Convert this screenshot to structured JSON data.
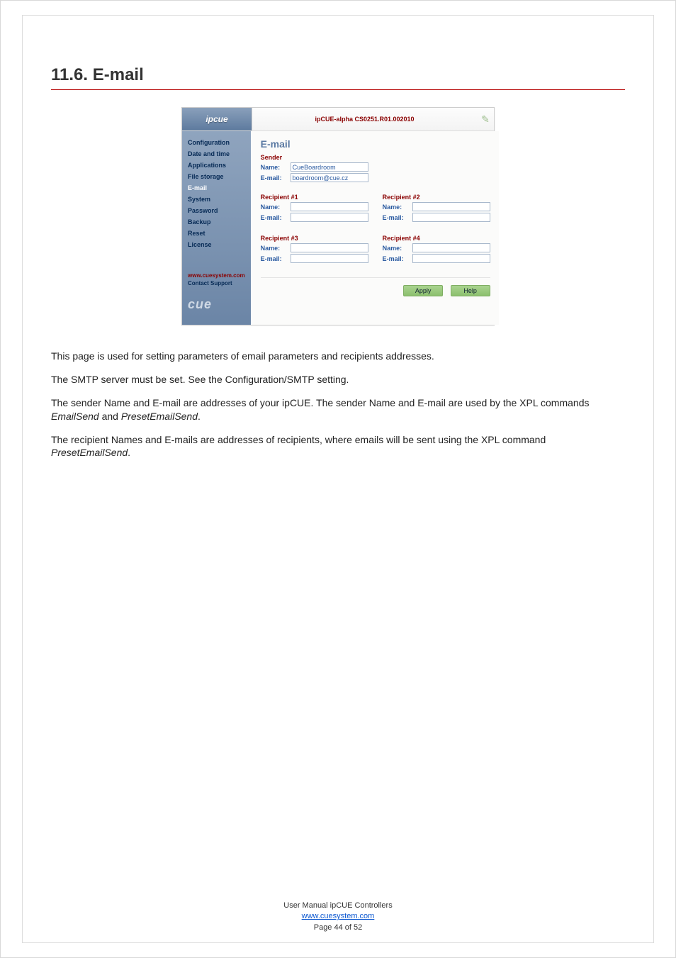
{
  "heading": "11.6.   E-mail",
  "screenshot": {
    "logo": "ipcue",
    "breadcrumb": "ipCUE-alpha   CS0251.R01.002010",
    "nav": {
      "items": [
        {
          "label": "Configuration",
          "active": false
        },
        {
          "label": "Date and time",
          "active": false
        },
        {
          "label": "Applications",
          "active": false
        },
        {
          "label": "File storage",
          "active": false
        },
        {
          "label": "E-mail",
          "active": true
        },
        {
          "label": "System",
          "active": false
        },
        {
          "label": "Password",
          "active": false
        },
        {
          "label": "Backup",
          "active": false
        },
        {
          "label": "Reset",
          "active": false
        },
        {
          "label": "License",
          "active": false
        }
      ],
      "link1": "www.cuesystem.com",
      "link2": "Contact Support",
      "brand": "cue"
    },
    "content": {
      "title": "E-mail",
      "sender": {
        "heading": "Sender",
        "name_label": "Name:",
        "name_value": "CueBoardroom",
        "email_label": "E-mail:",
        "email_value": "boardroom@cue.cz"
      },
      "recipients": [
        {
          "heading": "Recipient #1",
          "name_label": "Name:",
          "name_value": "",
          "email_label": "E-mail:",
          "email_value": ""
        },
        {
          "heading": "Recipient #2",
          "name_label": "Name:",
          "name_value": "",
          "email_label": "E-mail:",
          "email_value": ""
        },
        {
          "heading": "Recipient #3",
          "name_label": "Name:",
          "name_value": "",
          "email_label": "E-mail:",
          "email_value": ""
        },
        {
          "heading": "Recipient #4",
          "name_label": "Name:",
          "name_value": "",
          "email_label": "E-mail:",
          "email_value": ""
        }
      ],
      "apply": "Apply",
      "help": "Help"
    }
  },
  "paragraphs": {
    "p1": "This page is used for setting parameters of email parameters and recipients addresses.",
    "p2": "The SMTP server must be set. See the Configuration/SMTP setting.",
    "p3a": "The sender Name and E-mail are addresses of your ipCUE. The sender Name and E-mail are used by the XPL commands ",
    "p3b": "EmailSend",
    "p3c": " and ",
    "p3d": "PresetEmailSend",
    "p3e": ".",
    "p4a": "The recipient Names and E-mails are addresses of recipients, where emails will be sent using the XPL command ",
    "p4b": "PresetEmailSend",
    "p4c": "."
  },
  "footer": {
    "line1": "User Manual ipCUE Controllers",
    "link": "www.cuesystem.com",
    "line3": "Page 44 of 52"
  }
}
